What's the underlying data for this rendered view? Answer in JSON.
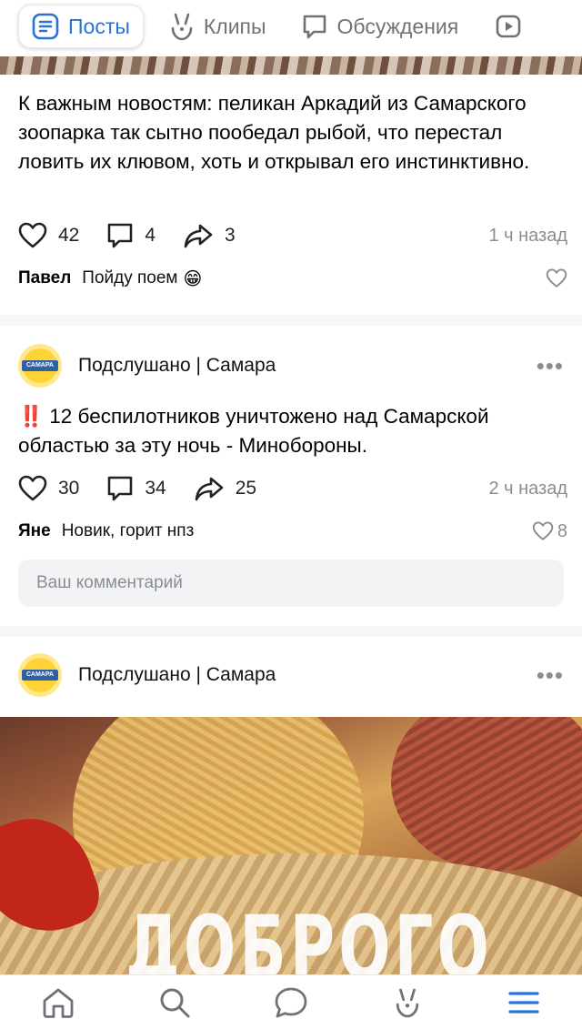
{
  "tabs": [
    {
      "label": "Посты",
      "icon": "posts-icon",
      "active": true
    },
    {
      "label": "Клипы",
      "icon": "clips-icon"
    },
    {
      "label": "Обсуждения",
      "icon": "discussions-icon"
    },
    {
      "label": "",
      "icon": "video-icon"
    }
  ],
  "post1": {
    "text": "К важным новостям: пеликан Аркадий из Самарского зоопарка так сытно пообедал рыбой, что перестал ловить их клювом, хоть и открывал его инстинктивно.",
    "likes": "42",
    "comments": "4",
    "shares": "3",
    "time": "1 ч назад",
    "comment": {
      "author": "Павел",
      "text": "Пойду поем",
      "emoji": "😁"
    }
  },
  "post2": {
    "group": "Подслушано | Самара",
    "avatar_label": "САМАРА",
    "alert": "‼️",
    "text": "12 беспилотников уничтожено над Самарской областью за эту ночь - Минобороны.",
    "likes": "30",
    "comments": "34",
    "shares": "25",
    "time": "2 ч назад",
    "comment": {
      "author": "Яне",
      "text": "Новик, горит нпз",
      "likes": "8"
    },
    "input_placeholder": "Ваш комментарий"
  },
  "post3": {
    "group": "Подслушано | Самара",
    "avatar_label": "САМАРА",
    "image_text": "ДОБРОГО"
  },
  "bottom_nav": [
    "home-icon",
    "search-icon",
    "messages-icon",
    "clips-icon",
    "menu-icon"
  ],
  "colors": {
    "accent": "#2a73d6",
    "muted": "#8a8d91",
    "alert": "#e0241b"
  }
}
